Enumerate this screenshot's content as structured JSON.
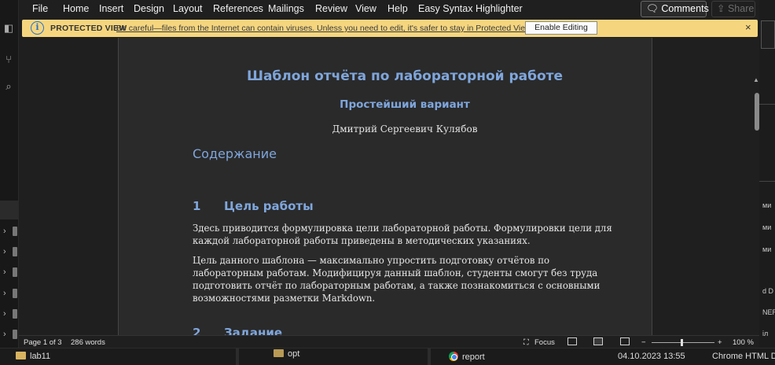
{
  "word": {
    "menu": [
      "File",
      "Home",
      "Insert",
      "Design",
      "Layout",
      "References",
      "Mailings",
      "Review",
      "View",
      "Help",
      "Easy Syntax Highlighter"
    ],
    "comments_label": "Comments",
    "share_label": "Share"
  },
  "protected": {
    "title": "PROTECTED VIEW",
    "message": "Be careful—files from the Internet can contain viruses. Unless you need to edit, it's safer to stay in Protected View.",
    "enable_label": "Enable Editing",
    "close_glyph": "×"
  },
  "document": {
    "title": "Шаблон отчёта по лабораторной работе",
    "subtitle": "Простейший вариант",
    "author": "Дмитрий Сергеевич Кулябов",
    "toc": "Содержание",
    "sections": [
      {
        "num": "1",
        "title": "Цель работы"
      },
      {
        "num": "2",
        "title": "Задание"
      }
    ],
    "para1_line1": "Здесь приводится формулировка цели лабораторной работы. Формулировки цели для",
    "para1_line2": "каждой лабораторной работы приведены в методических указаниях.",
    "para2_line1": "Цель данного шаблона — максимально упростить подготовку отчётов по",
    "para2_line2": "лабораторным работам. Модифицируя данный шаблон, студенты смогут без труда",
    "para2_line3": "подготовить отчёт по лабораторным работам, а также познакомиться с основными",
    "para2_line4": "возможностями разметки Markdown."
  },
  "status": {
    "page": "Page 1 of 3",
    "words": "286 words",
    "focus": "Focus",
    "zoom_minus": "−",
    "zoom_plus": "+",
    "zoom": "100 %"
  },
  "taskbar": {
    "folder1": "lab11",
    "folder2": "opt",
    "chrome_item": "report",
    "date": "04.10.2023 13:55",
    "doc_type": "Chrome HTML Do"
  },
  "right_fragments": [
    "ми",
    "ми",
    "ми",
    "d D",
    "NER",
    "іл"
  ],
  "icons": {
    "info": "info-icon",
    "comments": "comment-icon",
    "share": "share-icon"
  },
  "colors": {
    "heading": "#7fa6dc",
    "protected_bar": "#f5d67f",
    "info_icon": "#2a72c8"
  }
}
